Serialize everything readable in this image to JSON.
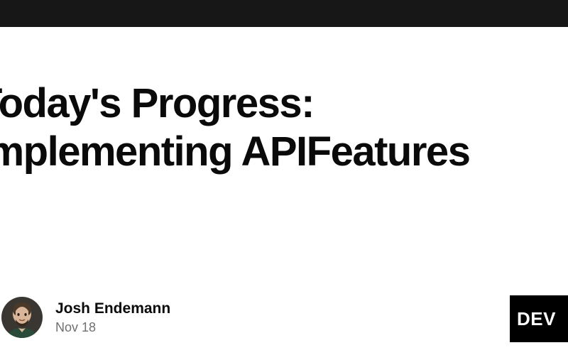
{
  "article": {
    "title_line1": "Today's Progress:",
    "title_line2": "Implementing APIFeatures"
  },
  "author": {
    "name": "Josh Endemann",
    "date": "Nov 18"
  },
  "badge": {
    "label": "DEV"
  }
}
